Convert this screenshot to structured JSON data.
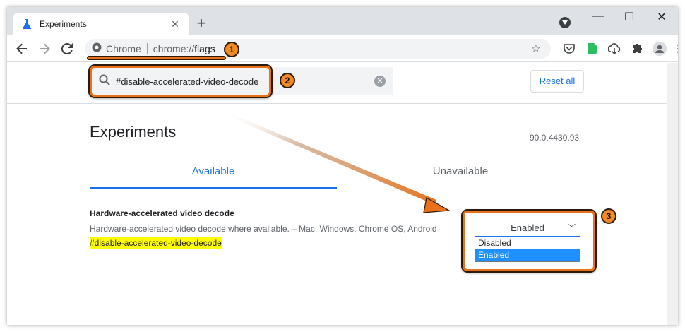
{
  "tab": {
    "title": "Experiments",
    "close_glyph": "✕"
  },
  "window_controls": {
    "minimize": "—",
    "maximize": "☐",
    "close": "✕"
  },
  "omnibox": {
    "site_label": "Chrome",
    "url_scheme": "chrome://",
    "url_path": "flags"
  },
  "search": {
    "value": "#disable-accelerated-video-decode",
    "clear_glyph": "✕"
  },
  "reset_label": "Reset all",
  "page_title": "Experiments",
  "version": "90.0.4430.93",
  "page_tabs": [
    {
      "label": "Available"
    },
    {
      "label": "Unavailable"
    }
  ],
  "experiment": {
    "name": "Hardware-accelerated video decode",
    "description": "Hardware-accelerated video decode where available. – Mac, Windows, Chrome OS, Android",
    "link": "#disable-accelerated-video-decode",
    "selected": "Enabled",
    "options": [
      "Disabled",
      "Enabled"
    ]
  },
  "annotations": {
    "badge1": "1",
    "badge2": "2",
    "badge3": "3"
  },
  "colors": {
    "accent": "#1a73e8",
    "callout": "#e8711a",
    "highlight": "#ffff00"
  }
}
